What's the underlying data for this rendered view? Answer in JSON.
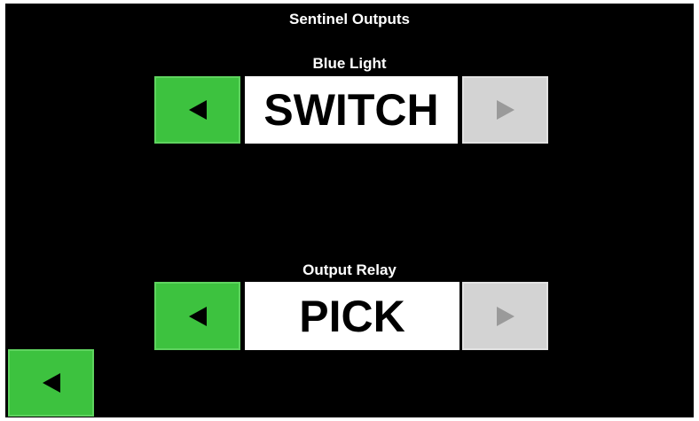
{
  "screen": {
    "title": "Sentinel Outputs"
  },
  "outputs": [
    {
      "label": "Blue Light",
      "value": "SWITCH",
      "prev_icon": "triangle-left-icon",
      "next_icon": "triangle-right-icon"
    },
    {
      "label": "Output Relay",
      "value": "PICK",
      "prev_icon": "triangle-left-icon",
      "next_icon": "triangle-right-icon"
    }
  ],
  "back": {
    "icon": "triangle-left-icon"
  },
  "colors": {
    "background": "#000000",
    "active_button": "#3dc23f",
    "disabled_button": "#d3d3d3",
    "value_box": "#ffffff"
  }
}
